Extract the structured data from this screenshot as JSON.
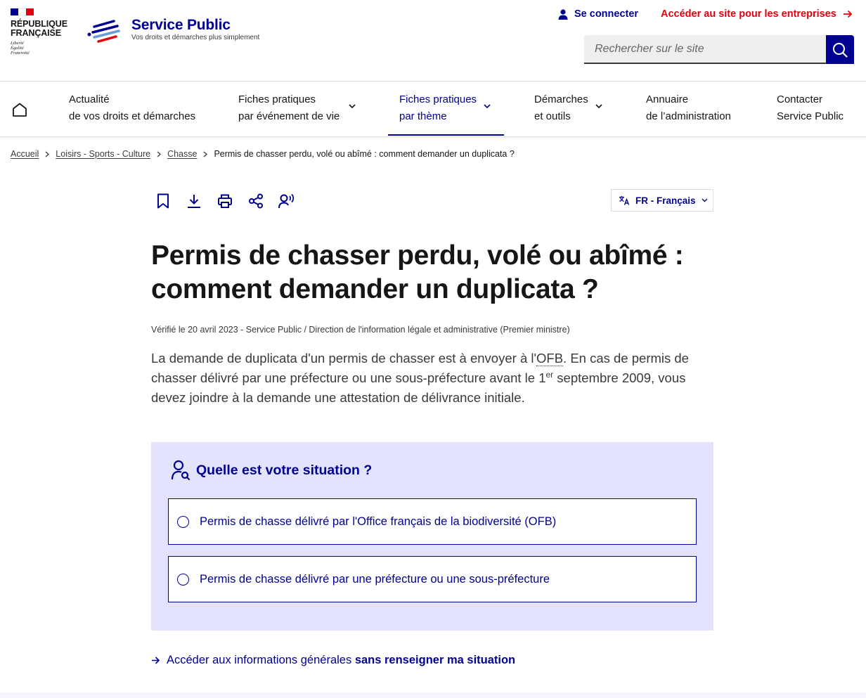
{
  "header": {
    "republic_name_line1": "RÉPUBLIQUE",
    "republic_name_line2": "FRANÇAISE",
    "motto": [
      "Liberté",
      "Égalité",
      "Fraternité"
    ],
    "site_title": "Service Public",
    "site_tagline": "Vos droits et démarches plus simplement",
    "connect_label": "Se connecter",
    "pro_link_label": "Accéder au site pour les entreprises",
    "search_placeholder": "Rechercher sur le site"
  },
  "nav": {
    "items": [
      {
        "line1": "Actualité",
        "line2": "de vos droits et démarches"
      },
      {
        "line1": "Fiches pratiques",
        "line2": "par événement de vie"
      },
      {
        "line1": "Fiches pratiques",
        "line2": "par thème"
      },
      {
        "line1": "Démarches",
        "line2": "et outils"
      },
      {
        "line1": "Annuaire",
        "line2": "de l’administration"
      },
      {
        "line1": "Contacter",
        "line2": "Service Public"
      }
    ]
  },
  "breadcrumb": {
    "items": [
      "Accueil",
      "Loisirs - Sports - Culture",
      "Chasse"
    ],
    "current": "Permis de chasser perdu, volé ou abîmé : comment demander un duplicata ?"
  },
  "toolbar": {
    "language_label": "FR - Français"
  },
  "article": {
    "title": "Permis de chasser perdu, volé ou abîmé : comment demander un duplicata ?",
    "verified": "Vérifié le 20 avril 2023 - Service Public / Direction de l'information légale et administrative (Premier ministre)",
    "intro_part1": "La demande de duplicata d'un permis de chasser est à envoyer à l'",
    "intro_abbr": "OFB",
    "intro_part2": ". En cas de permis de chasser délivré par une préfecture ou une sous-préfecture avant le 1",
    "intro_sup": "er",
    "intro_part3": " septembre 2009, vous devez joindre à la demande une attestation de délivrance initiale."
  },
  "situation": {
    "title": "Quelle est votre situation ?",
    "choices": [
      "Permis de chasse délivré par l'Office français de la biodiversité (OFB)",
      "Permis de chasse délivré par une préfecture ou une sous-préfecture"
    ]
  },
  "general_link": {
    "prefix": "Accéder aux informations générales ",
    "bold": "sans renseigner ma situation"
  },
  "colors": {
    "primary_blue": "#000091",
    "marianne_red": "#e1000f",
    "situation_bg": "#e3e3fd"
  }
}
